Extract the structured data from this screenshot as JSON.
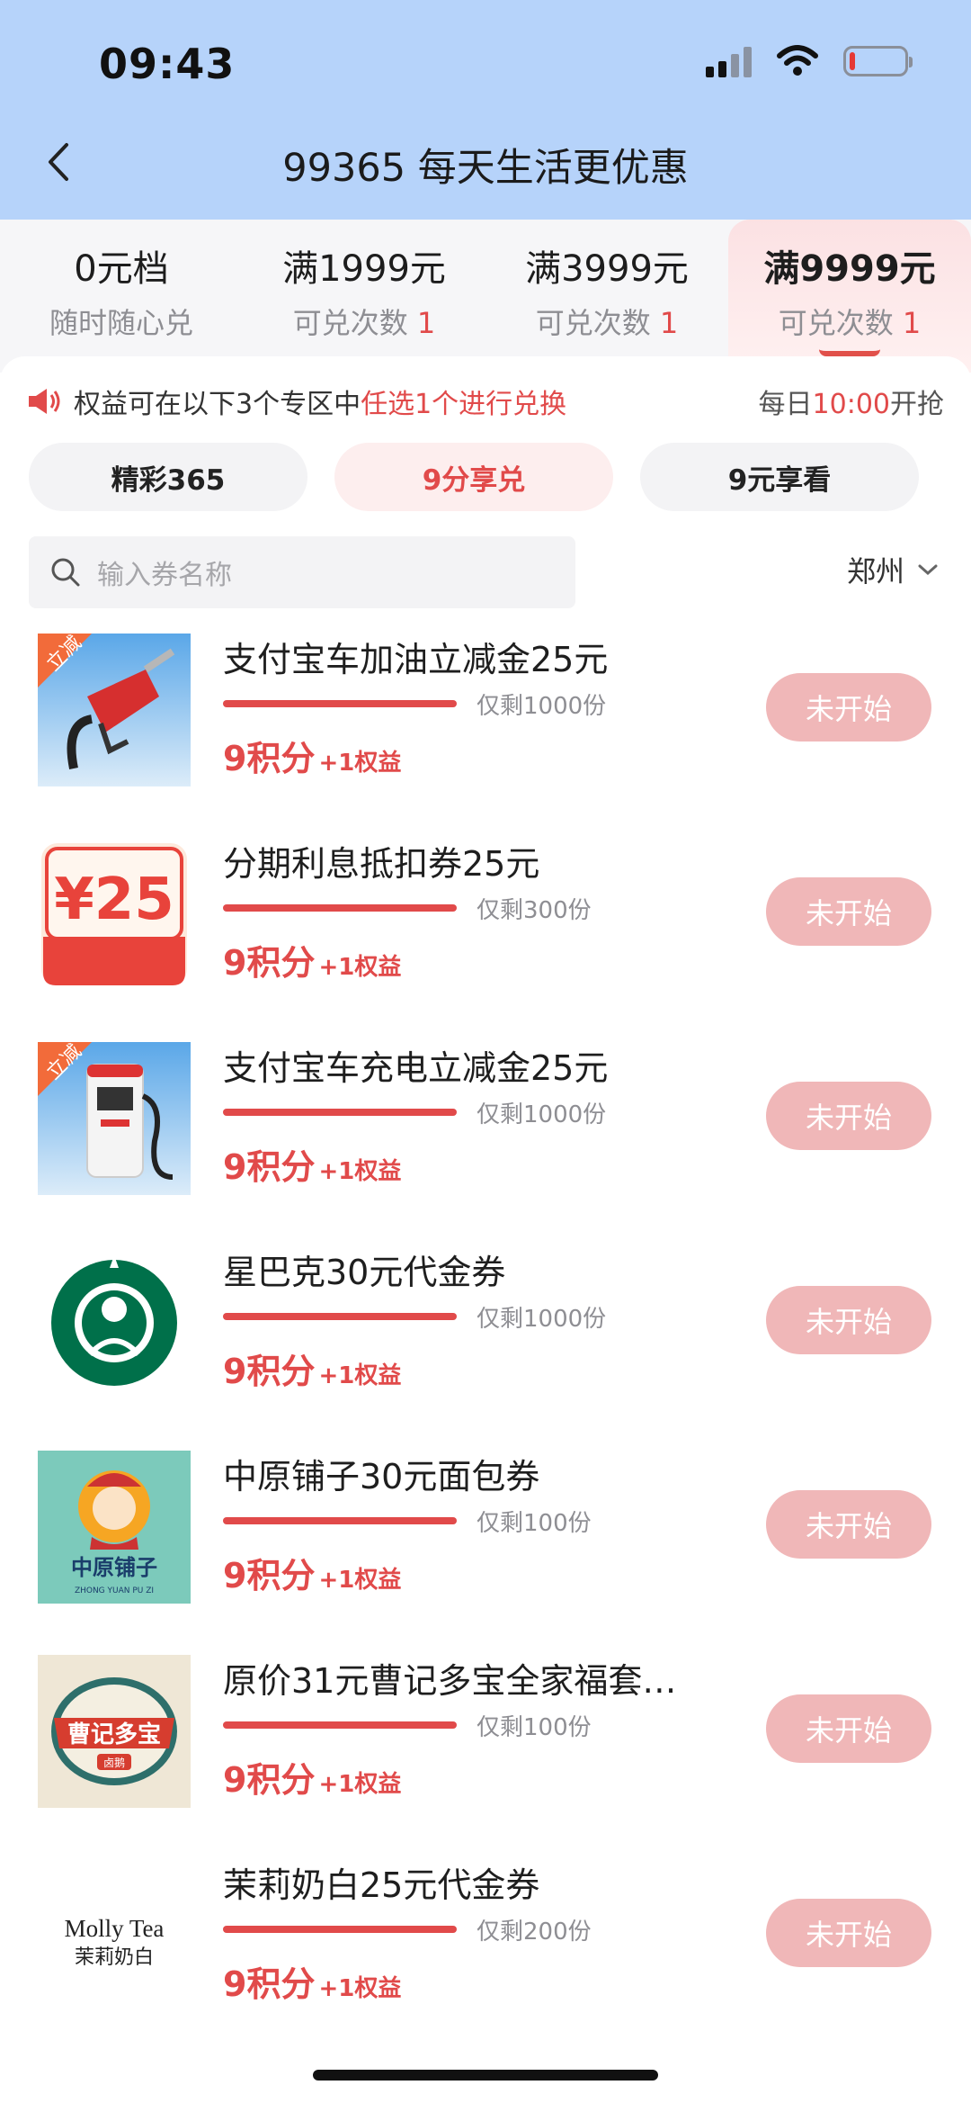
{
  "status": {
    "time": "09:43"
  },
  "header": {
    "title": "99365 每天生活更优惠"
  },
  "tiers": [
    {
      "title": "0元档",
      "sub": "随时随心兑",
      "count": ""
    },
    {
      "title": "满1999元",
      "sub": "可兑次数",
      "count": "1"
    },
    {
      "title": "满3999元",
      "sub": "可兑次数",
      "count": "1"
    },
    {
      "title": "满9999元",
      "sub": "可兑次数",
      "count": "1"
    }
  ],
  "notice": {
    "prefix": "权益可在以下3个专区中",
    "highlight": "任选1个进行兑换",
    "right_prefix": "每日",
    "right_time": "10:00",
    "right_suffix": "开抢"
  },
  "zones": [
    "精彩365",
    "9分享兑",
    "9元享看"
  ],
  "search": {
    "placeholder": "输入券名称"
  },
  "city": "郑州",
  "items": [
    {
      "name": "支付宝车加油立减金25元",
      "remain": "仅剩1000份",
      "price": "9积分",
      "bonus": "+1权益",
      "button": "未开始",
      "icon": "fuel-nozzle-icon",
      "badge": "立减"
    },
    {
      "name": "分期利息抵扣券25元",
      "remain": "仅剩300份",
      "price": "9积分",
      "bonus": "+1权益",
      "button": "未开始",
      "icon": "coupon-25-icon",
      "coupon_text": "¥25"
    },
    {
      "name": "支付宝车充电立减金25元",
      "remain": "仅剩1000份",
      "price": "9积分",
      "bonus": "+1权益",
      "button": "未开始",
      "icon": "ev-charger-icon",
      "badge": "立减"
    },
    {
      "name": "星巴克30元代金券",
      "remain": "仅剩1000份",
      "price": "9积分",
      "bonus": "+1权益",
      "button": "未开始",
      "icon": "starbucks-logo"
    },
    {
      "name": "中原铺子30元面包券",
      "remain": "仅剩100份",
      "price": "9积分",
      "bonus": "+1权益",
      "button": "未开始",
      "icon": "zhongyuan-puzi-logo",
      "logo_text": "中原铺子",
      "logo_sub": "ZHONG YUAN PU ZI"
    },
    {
      "name": "原价31元曹记多宝全家福套…",
      "remain": "仅剩100份",
      "price": "9积分",
      "bonus": "+1权益",
      "button": "未开始",
      "icon": "caoji-duobao-logo",
      "logo_text": "曹记多宝",
      "logo_sub": "卤鹅"
    },
    {
      "name": "茉莉奶白25元代金券",
      "remain": "仅剩200份",
      "price": "9积分",
      "bonus": "+1权益",
      "button": "未开始",
      "icon": "molly-tea-logo",
      "logo_text": "Molly Tea",
      "logo_sub": "茉莉奶白"
    }
  ],
  "colors": {
    "header_bg": "#b6d3fa",
    "accent": "#e14a4a",
    "button_disabled": "#f0b7b8"
  }
}
